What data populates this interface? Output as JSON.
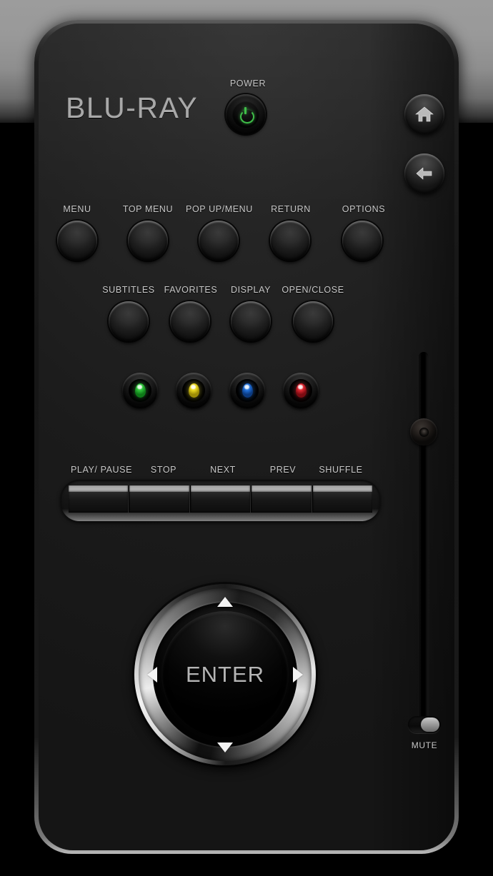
{
  "device": {
    "brand": "BLU-RAY",
    "type": "blu-ray-remote-control"
  },
  "power": {
    "label": "POWER",
    "icon": "power-icon",
    "led_color": "#3fbf49"
  },
  "side_buttons": [
    {
      "name": "home-button",
      "icon": "home-icon"
    },
    {
      "name": "back-button",
      "icon": "back-arrow-icon"
    }
  ],
  "menu_row": {
    "buttons": [
      {
        "label": "MENU"
      },
      {
        "label": "TOP MENU"
      },
      {
        "label": "POP UP/MENU"
      },
      {
        "label": "RETURN"
      },
      {
        "label": "OPTIONS"
      }
    ]
  },
  "function_row": {
    "buttons": [
      {
        "label": "SUBTITLES"
      },
      {
        "label": "FAVORITES"
      },
      {
        "label": "DISPLAY"
      },
      {
        "label": "OPEN/CLOSE"
      }
    ]
  },
  "color_row": {
    "buttons": [
      {
        "name": "green-button",
        "color": "#2fc23a",
        "top": "#6fe878"
      },
      {
        "name": "yellow-button",
        "color": "#e8d61f",
        "top": "#fbf27a"
      },
      {
        "name": "blue-button",
        "color": "#1f6ed8",
        "top": "#7fb4f2"
      },
      {
        "name": "red-button",
        "color": "#dc2630",
        "top": "#f4848a"
      }
    ]
  },
  "transport": {
    "labels": [
      "PLAY/ PAUSE",
      "STOP",
      "NEXT",
      "PREV",
      "SHUFFLE"
    ]
  },
  "dpad": {
    "center_label": "ENTER",
    "up": "up-arrow",
    "down": "down-arrow",
    "left": "left-arrow",
    "right": "right-arrow"
  },
  "volume": {
    "name": "volume-slider",
    "knob_position_percent": 18
  },
  "mute": {
    "label": "MUTE",
    "state": "on"
  },
  "colors": {
    "body": "#1a1a1a",
    "backdrop_top": "#999999",
    "backdrop_bottom": "#000000",
    "label_text": "#c9c9c9",
    "brand_text": "#a8a8a8",
    "chrome": "#e8e8e8"
  }
}
